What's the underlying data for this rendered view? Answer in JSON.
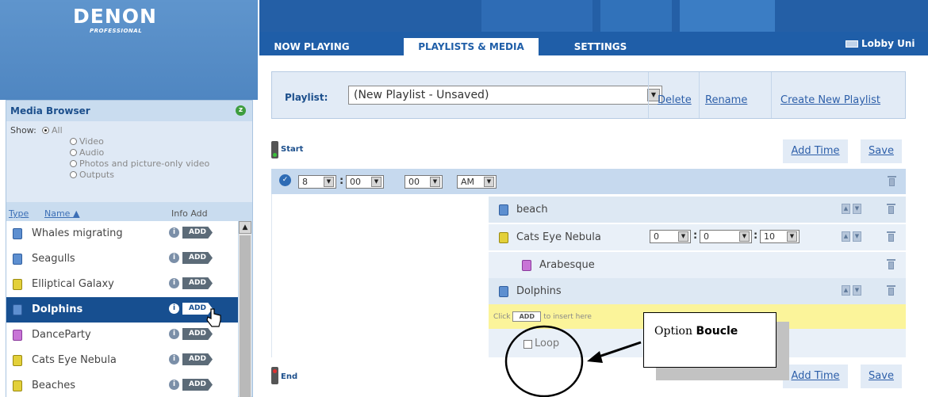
{
  "logo": {
    "brand": "DENON",
    "sub": "PROFESSIONAL"
  },
  "topbar": {
    "tabs": [
      {
        "label": "NOW PLAYING",
        "active": false
      },
      {
        "label": "PLAYLISTS & MEDIA",
        "active": true
      },
      {
        "label": "SETTINGS",
        "active": false
      }
    ],
    "zone": "Lobby Uni"
  },
  "media_browser": {
    "title": "Media Browser",
    "collapse_icon": "z",
    "show_label": "Show:",
    "show_options": [
      {
        "label": "All",
        "selected": true
      },
      {
        "label": "Video",
        "selected": false
      },
      {
        "label": "Audio",
        "selected": false
      },
      {
        "label": "Photos and picture-only video",
        "selected": false
      },
      {
        "label": "Outputs",
        "selected": false
      }
    ],
    "columns": {
      "type": "Type",
      "name": "Name ▲",
      "info_add": "Info Add"
    },
    "items": [
      {
        "name": "Whales migrating",
        "type": "video",
        "info": "i",
        "add": "ADD"
      },
      {
        "name": "Seagulls",
        "type": "video",
        "info": "i",
        "add": "ADD"
      },
      {
        "name": "Elliptical Galaxy",
        "type": "photo",
        "info": "i",
        "add": "ADD"
      },
      {
        "name": "Dolphins",
        "type": "video",
        "info": "i",
        "add": "ADD",
        "selected": true
      },
      {
        "name": "DanceParty",
        "type": "audio",
        "info": "i",
        "add": "ADD"
      },
      {
        "name": "Cats Eye Nebula",
        "type": "photo",
        "info": "i",
        "add": "ADD"
      },
      {
        "name": "Beaches",
        "type": "photo",
        "info": "i",
        "add": "ADD"
      }
    ]
  },
  "playlist_bar": {
    "label": "Playlist:",
    "selected": "(New Playlist - Unsaved)",
    "delete": "Delete",
    "rename": "Rename",
    "create": "Create New Playlist"
  },
  "timeline": {
    "start_label": "Start",
    "end_label": "End",
    "add_time": "Add Time",
    "save": "Save",
    "time": {
      "hour": "8",
      "minute": "00",
      "second": "00",
      "ampm": "AM"
    },
    "items": [
      {
        "name": "beach",
        "type": "video"
      },
      {
        "name": "Cats Eye Nebula",
        "type": "photo",
        "duration": [
          "0",
          "0",
          "10"
        ]
      },
      {
        "name": "Arabesque",
        "type": "audio"
      },
      {
        "name": "Dolphins",
        "type": "video"
      }
    ],
    "insert_hint_pre": "Click",
    "insert_hint_btn": "ADD",
    "insert_hint_post": "to insert here",
    "loop_label": "Loop"
  },
  "annotation": {
    "prefix": "Option",
    "bold": "Boucle"
  },
  "colors": {
    "accent": "#1f5ea8",
    "selected_row": "#174f90",
    "insert_highlight": "#fbf49a"
  }
}
